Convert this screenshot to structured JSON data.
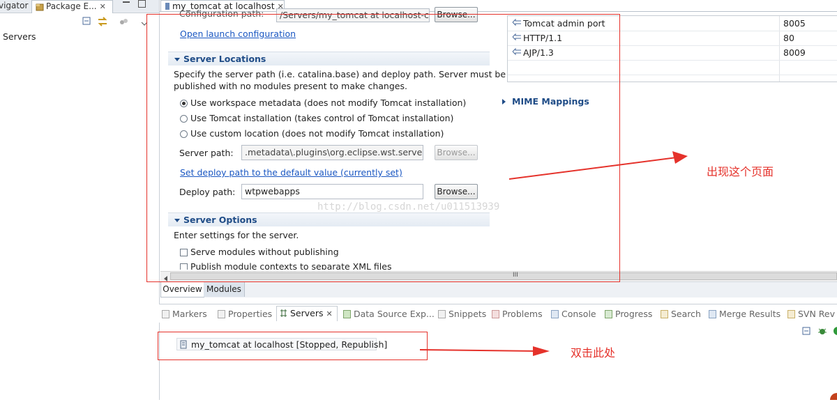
{
  "left": {
    "tabs": [
      {
        "label": "vigator"
      },
      {
        "label": "Package E..."
      }
    ],
    "tree_item": "Servers"
  },
  "editor": {
    "tab_label": "my_tomcat at localhost",
    "config_path_label": "Configuration path:",
    "config_path_value": "/Servers/my_tomcat at localhost-con",
    "browse_label": "Browse...",
    "open_launch_config": "Open launch configuration",
    "server_locations": {
      "title": "Server Locations",
      "description_line1": "Specify the server path (i.e. catalina.base) and deploy path. Server must be",
      "description_line2": "published with no modules present to make changes.",
      "options": [
        {
          "label": "Use workspace metadata (does not modify Tomcat installation)",
          "selected": true
        },
        {
          "label": "Use Tomcat installation (takes control of Tomcat installation)",
          "selected": false
        },
        {
          "label": "Use custom location (does not modify Tomcat installation)",
          "selected": false
        }
      ],
      "server_path_label": "Server path:",
      "server_path_value": ".metadata\\.plugins\\org.eclipse.wst.server.co",
      "set_deploy_link": "Set deploy path to the default value (currently set)",
      "deploy_path_label": "Deploy path:",
      "deploy_path_value": "wtpwebapps"
    },
    "server_options": {
      "title": "Server Options",
      "description": "Enter settings for the server.",
      "checkboxes": [
        {
          "label": "Serve modules without publishing",
          "checked": false
        },
        {
          "label": "Publish module contexts to separate XML files",
          "checked": false
        }
      ]
    },
    "ports": [
      {
        "name": "Tomcat admin port",
        "port": "8005"
      },
      {
        "name": "HTTP/1.1",
        "port": "80"
      },
      {
        "name": "AJP/1.3",
        "port": "8009"
      }
    ],
    "mime_mappings": "MIME Mappings",
    "scroll_grip": "III",
    "bottom_tabs": [
      {
        "label": "Overview"
      },
      {
        "label": "Modules"
      }
    ]
  },
  "views": {
    "tabs": [
      {
        "label": "Markers"
      },
      {
        "label": "Properties"
      },
      {
        "label": "Servers"
      },
      {
        "label": "Data Source Exp..."
      },
      {
        "label": "Snippets"
      },
      {
        "label": "Problems"
      },
      {
        "label": "Console"
      },
      {
        "label": "Progress"
      },
      {
        "label": "Search"
      },
      {
        "label": "Merge Results"
      },
      {
        "label": "SVN Rev"
      }
    ],
    "server_entry": "my_tomcat at localhost  [Stopped, Republish]"
  },
  "annotations": {
    "watermark": "http://blog.csdn.net/u011513939",
    "top_note": "出现这个页面",
    "bottom_note": "双击此处",
    "color": "#e5322b"
  }
}
